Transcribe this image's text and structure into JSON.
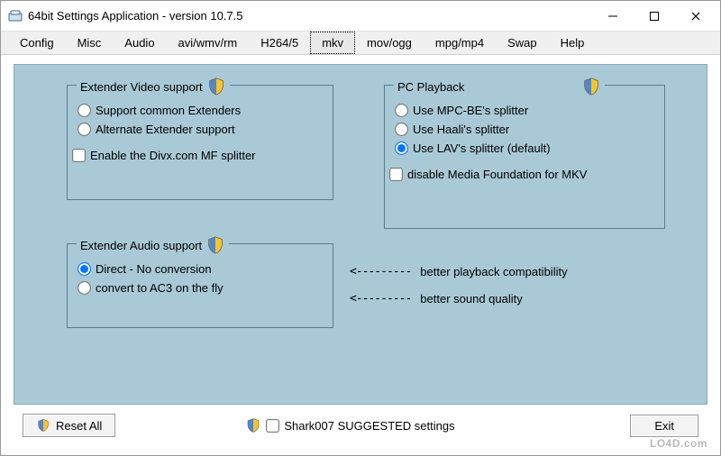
{
  "icons": {
    "shield": "shield-icon",
    "app": "app-icon"
  },
  "titlebar": {
    "title": "64bit Settings Application - version 10.7.5"
  },
  "menubar": {
    "items": [
      "Config",
      "Misc",
      "Audio",
      "avi/wmv/rm",
      "H264/5",
      "mkv",
      "mov/ogg",
      "mpg/mp4",
      "Swap",
      "Help"
    ],
    "active_index": 5
  },
  "groups": {
    "extender_video": {
      "legend": "Extender Video support",
      "radios": [
        {
          "label": "Support common Extenders",
          "checked": false
        },
        {
          "label": "Alternate Extender support",
          "checked": false
        }
      ],
      "checkbox": {
        "label": "Enable the Divx.com MF splitter",
        "checked": false
      }
    },
    "pc_playback": {
      "legend": "PC Playback",
      "radios": [
        {
          "label": "Use MPC-BE's splitter",
          "checked": false
        },
        {
          "label": "Use Haali's splitter",
          "checked": false
        },
        {
          "label": "Use LAV's splitter (default)",
          "checked": true
        }
      ],
      "checkbox": {
        "label": "disable Media Foundation for MKV",
        "checked": false
      }
    },
    "extender_audio": {
      "legend": "Extender Audio support",
      "radios": [
        {
          "label": "Direct - No conversion",
          "checked": true
        },
        {
          "label": "convert to AC3 on the fly",
          "checked": false
        }
      ]
    }
  },
  "annotations": {
    "arrow": "<---------",
    "line1": "better playback compatibility",
    "line2": "better sound quality"
  },
  "footer": {
    "reset_label": "Reset All",
    "suggest_label": "Shark007 SUGGESTED settings",
    "suggest_checked": false,
    "exit_label": "Exit"
  },
  "watermark": "LO4D.com"
}
